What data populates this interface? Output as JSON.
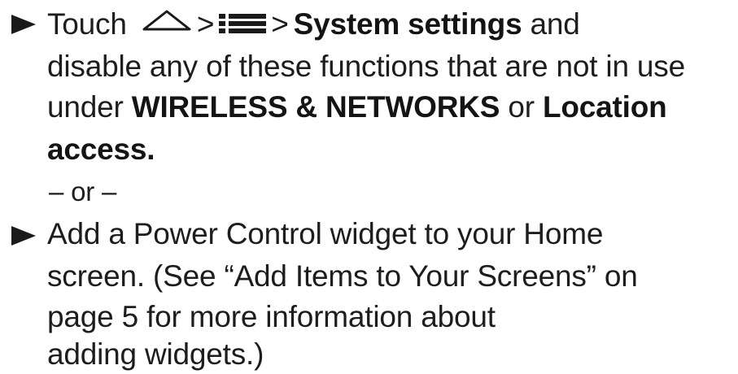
{
  "step1": {
    "line1": {
      "touch": "Touch",
      "sep1": ">",
      "sep2": ">",
      "system_settings": "System settings",
      "and": " and"
    },
    "line2": "disable any of these functions that are not in use",
    "line3": {
      "under": "under ",
      "wireless": "WIRELESS & NETWORKS",
      "or": " or ",
      "location": "Location"
    },
    "line4": "access."
  },
  "separator": "– or –",
  "step2": {
    "line1": "Add a Power Control widget to your Home",
    "line2": "screen. (See “Add Items to Your Screens” on",
    "line3": "page 5 for more information about",
    "line4": "adding widgets.)"
  },
  "icons": {
    "home": "home-icon",
    "menu": "menu-icon",
    "bullet": "triangle-bullet-icon"
  }
}
